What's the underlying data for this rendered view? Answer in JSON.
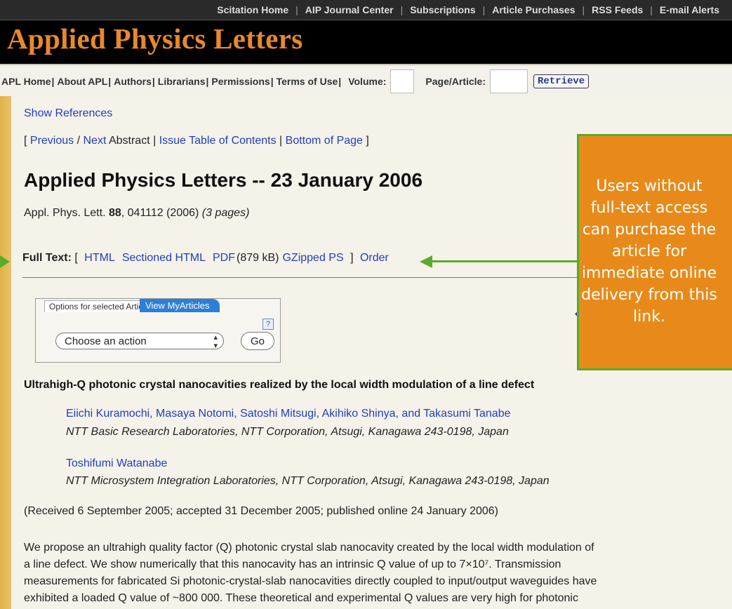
{
  "top_nav": {
    "items": [
      "Scitation Home",
      "AIP Journal Center",
      "Subscriptions",
      "Article Purchases",
      "RSS Feeds",
      "E-mail Alerts"
    ]
  },
  "masthead": {
    "title": "Applied Physics Letters"
  },
  "sub_nav": {
    "links": [
      "APL Home",
      "About APL",
      "Authors",
      "Librarians",
      "Permissions",
      "Terms of Use"
    ],
    "volume_label": "Volume:",
    "page_label": "Page/Article:",
    "retrieve_label": "Retrieve"
  },
  "content": {
    "show_references": "Show References",
    "prev_next": {
      "open": "[ ",
      "previous": "Previous",
      "slash": " / ",
      "next": "Next",
      "abstract": " Abstract | ",
      "toc": "Issue Table of Contents",
      "pipe": " | ",
      "bottom": "Bottom of Page",
      "close": " ]"
    },
    "issue_title": "Applied Physics Letters -- 23 January 2006",
    "citation": {
      "journal": "Appl. Phys. Lett. ",
      "volume": "88",
      "pages": ", 041112 (2006) ",
      "length": "(3 pages)"
    },
    "full_text": {
      "label": "Full Text:",
      "open": " [ ",
      "html": "HTML",
      "sectioned": "Sectioned HTML",
      "pdf": "PDF",
      "pdf_size": "(879 kB)",
      "gzipped": "GZipped PS",
      "close": " ] ",
      "order": "Order"
    },
    "options": {
      "tab_options": "Options for selected Articles",
      "tab_myarticles": "View MyArticles",
      "help": "?",
      "select_value": "Choose an action",
      "go": "Go"
    },
    "article_title": "Ultrahigh-Q photonic crystal nanocavities realized by the local width modulation of a line defect",
    "authors_1": "Eiichi Kuramochi, Masaya Notomi, Satoshi Mitsugi, Akihiko Shinya, and Takasumi Tanabe",
    "affiliation_1": "NTT Basic Research Laboratories, NTT Corporation, Atsugi, Kanagawa 243-0198, Japan",
    "authors_2": "Toshifumi Watanabe",
    "affiliation_2": "NTT Microsystem Integration Laboratories, NTT Corporation, Atsugi, Kanagawa 243-0198, Japan",
    "received": "(Received 6 September 2005; accepted 31 December 2005; published online 24 January 2006)",
    "abstract_lines": [
      "We propose an ultrahigh quality factor (Q) photonic crystal slab nanocavity created by the local width modulation of",
      "a line defect. We show numerically that this nanocavity has an intrinsic Q value of up to 7×10⁷. Transmission",
      "measurements for fabricated Si photonic-crystal-slab nanocavities directly coupled to input/output waveguides have",
      "exhibited a loaded Q value of ~800 000. These theoretical and experimental Q values are very high for photonic"
    ]
  },
  "callout": {
    "text": "Users without full-text access can purchase the article for immediate online delivery from this link."
  },
  "colors": {
    "accent_orange": "#e88a1a",
    "arrow_green": "#5caa2c",
    "link_blue": "#1f3fbf"
  }
}
